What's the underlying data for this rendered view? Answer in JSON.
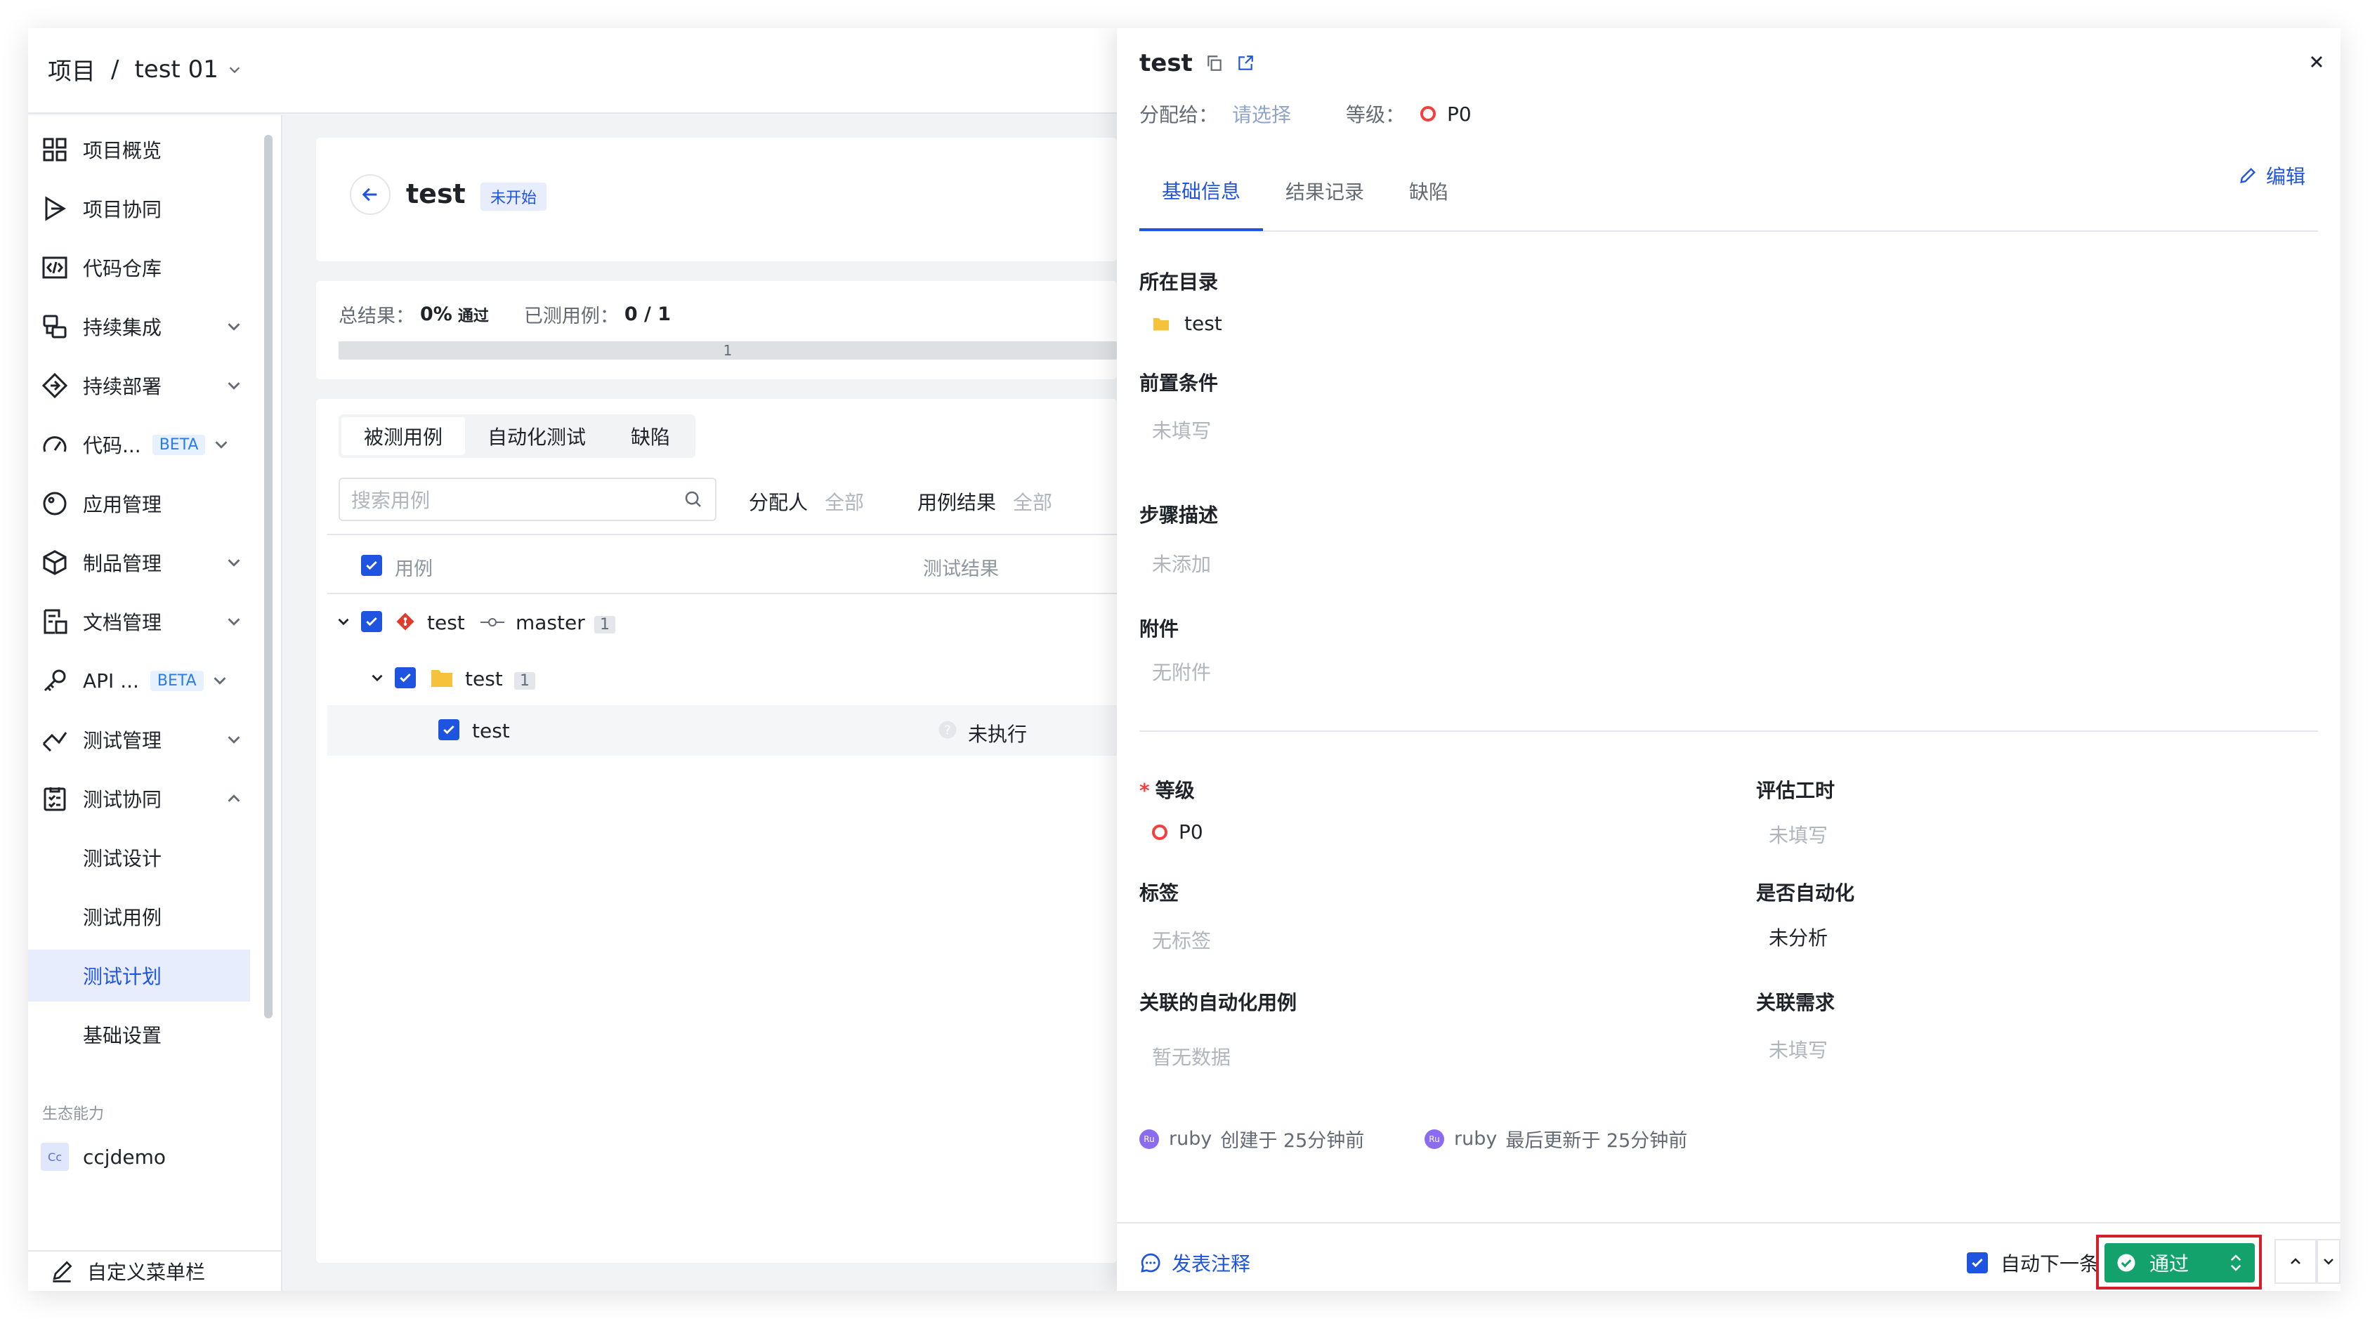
{
  "breadcrumb": {
    "root": "项目",
    "separator": "/",
    "project": "test 01"
  },
  "sidebar": {
    "items": [
      {
        "label": "项目概览",
        "icon": "overview-icon"
      },
      {
        "label": "项目协同",
        "icon": "collab-icon"
      },
      {
        "label": "代码仓库",
        "icon": "code-repo-icon"
      },
      {
        "label": "持续集成",
        "icon": "ci-icon"
      },
      {
        "label": "持续部署",
        "icon": "cd-icon"
      },
      {
        "label": "代码...",
        "icon": "code-scan-icon",
        "badge": "BETA"
      },
      {
        "label": "应用管理",
        "icon": "app-icon"
      },
      {
        "label": "制品管理",
        "icon": "artifact-icon"
      },
      {
        "label": "文档管理",
        "icon": "docs-icon"
      },
      {
        "label": "API ...",
        "icon": "api-icon",
        "badge": "BETA"
      },
      {
        "label": "测试管理",
        "icon": "test-mgmt-icon"
      },
      {
        "label": "测试协同",
        "icon": "test-collab-icon"
      },
      {
        "label": "测试设计"
      },
      {
        "label": "测试用例"
      },
      {
        "label": "测试计划"
      },
      {
        "label": "基础设置"
      }
    ],
    "ecosystem_label": "生态能力",
    "ecosystem_item": {
      "avatar": "Cc",
      "label": "ccjdemo"
    },
    "customize": "自定义菜单栏"
  },
  "plan": {
    "title": "test",
    "status": "未开始",
    "summary_label": "总结果：",
    "summary_value": "0%",
    "summary_pass": "通过",
    "tested_label": "已测用例：",
    "tested_value": "0 / 1",
    "progress_label": "1",
    "progress": 0
  },
  "case_tabs": [
    "被测用例",
    "自动化测试",
    "缺陷"
  ],
  "search_placeholder": "搜索用例",
  "filters": {
    "assignee_label": "分配人",
    "assignee_value": "全部",
    "result_label": "用例结果",
    "result_value": "全部"
  },
  "table": {
    "col_case": "用例",
    "col_result": "测试结果",
    "rows": [
      {
        "name": "test",
        "branch": "master",
        "count": "1"
      },
      {
        "name": "test",
        "count": "1"
      },
      {
        "name": "test",
        "result": "未执行"
      }
    ]
  },
  "drawer": {
    "title": "test",
    "assign_label": "分配给：",
    "assign_value": "请选择",
    "level_label": "等级：",
    "level_value": "P0",
    "tabs": [
      "基础信息",
      "结果记录",
      "缺陷"
    ],
    "edit": "编辑",
    "dir_label": "所在目录",
    "dir_value": "test",
    "pre_label": "前置条件",
    "pre_value": "未填写",
    "steps_label": "步骤描述",
    "steps_value": "未添加",
    "attach_label": "附件",
    "attach_value": "无附件",
    "grade_label": "等级",
    "grade_value": "P0",
    "estimate_label": "评估工时",
    "estimate_value": "未填写",
    "tags_label": "标签",
    "tags_value": "无标签",
    "auto_label": "是否自动化",
    "auto_value": "未分析",
    "linked_auto_label": "关联的自动化用例",
    "linked_auto_value": "暂无数据",
    "linked_req_label": "关联需求",
    "linked_req_value": "未填写",
    "created": {
      "avatar": "Ru",
      "user": "ruby",
      "text": "创建于  25分钟前"
    },
    "updated": {
      "avatar": "Ru",
      "user": "ruby",
      "text": "最后更新于  25分钟前"
    },
    "comment": "发表注释",
    "auto_next": "自动下一条",
    "pass": "通过"
  },
  "colors": {
    "accent": "#1f54e0",
    "pass_green": "#13a26b",
    "highlight_red": "#d4202b",
    "priority_red": "#f53f3f"
  }
}
